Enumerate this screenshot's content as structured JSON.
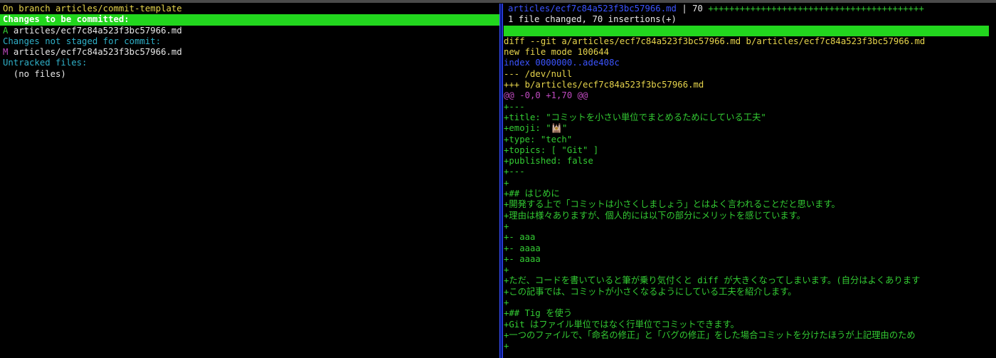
{
  "status": {
    "branch_line": "On branch articles/commit-template",
    "staged_header": "Changes to be committed:",
    "staged_files": [
      {
        "status": "A",
        "path": "articles/ecf7c84a523f3bc57966.md"
      }
    ],
    "unstaged_header": "Changes not staged for commit:",
    "unstaged_files": [
      {
        "status": "M",
        "path": "articles/ecf7c84a523f3bc57966.md"
      }
    ],
    "untracked_header": "Untracked files:",
    "untracked_empty": "  (no files)"
  },
  "diff": {
    "stat_file": "articles/ecf7c84a523f3bc57966.md",
    "stat_sep": " | 70 ",
    "stat_plus": "+++++++++++++++++++++++++++++++++++++++++",
    "stat_summary": "1 file changed, 70 insertions(+)",
    "header_lines": [
      {
        "text": "diff --git a/articles/ecf7c84a523f3bc57966.md b/articles/ecf7c84a523f3bc57966.md",
        "color": "yellow"
      },
      {
        "text": "new file mode 100644",
        "color": "yellow"
      },
      {
        "text": "index 0000000..ade408c",
        "color": "blue"
      },
      {
        "text": "--- /dev/null",
        "color": "yellow"
      },
      {
        "text": "+++ b/articles/ecf7c84a523f3bc57966.md",
        "color": "yellow"
      },
      {
        "text": "@@ -0,0 +1,70 @@",
        "color": "magenta"
      }
    ],
    "added_lines": [
      "+---",
      "+title: \"コミットを小さい単位でまとめるためにしている工夫\"",
      "+emoji: \"🕍\"",
      "+type: \"tech\"",
      "+topics: [ \"Git\" ]",
      "+published: false",
      "+---",
      "+",
      "+## はじめに",
      "+開発する上で「コミットは小さくしましょう」とはよく言われることだと思います。",
      "+理由は様々ありますが、個人的には以下の部分にメリットを感じています。",
      "+",
      "+- aaa",
      "+- aaaa",
      "+- aaaa",
      "+",
      "+ただ、コードを書いていると筆が乗り気付くと diff が大きくなってしまいます。(自分はよくあります",
      "+この記事では、コミットが小さくなるようにしている工夫を紹介します。",
      "+",
      "+## Tig を使う",
      "+Git はファイル単位ではなく行単位でコミットできます。",
      "+一つのファイルで、「命名の修正」と「バグの修正」をした場合コミットを分けたほうが上記理由のため",
      "+"
    ]
  },
  "colors": {
    "highlight": "#22d61e",
    "separator": "#0a1a8c",
    "added": "#33cc33",
    "header": "#e6d44c",
    "section": "#2fb0c8"
  }
}
